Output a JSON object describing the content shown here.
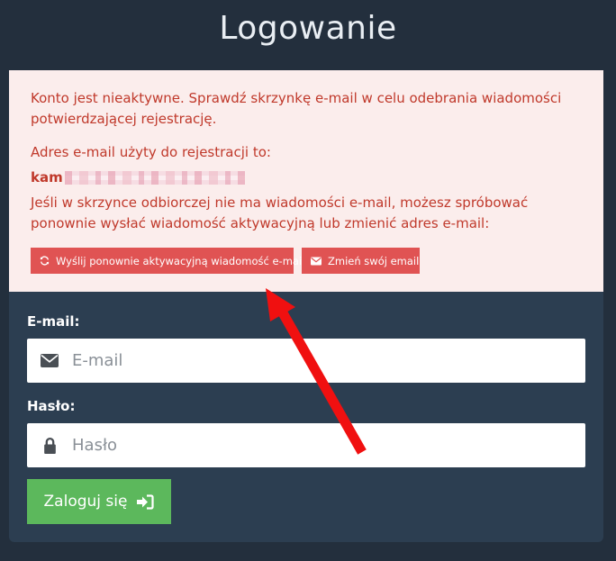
{
  "page": {
    "title": "Logowanie"
  },
  "alert": {
    "message": "Konto jest nieaktywne. Sprawdź skrzynkę e-mail w celu odebrania wiadomości potwierdzającej rejestrację.",
    "address_label": "Adres e-mail użyty do rejestracji to:",
    "email_visible": "kam",
    "instructions": "Jeśli w skrzynce odbiorczej nie ma wiadomości e-mail, możesz spróbować ponownie wysłać wiadomość aktywacyjną lub zmienić adres e-mail:",
    "resend_label": "Wyślij ponownie aktywacyjną wiadomość e-mail",
    "change_label": "Zmień swój email"
  },
  "form": {
    "email_label": "E-mail:",
    "email_placeholder": "E-mail",
    "email_value": "",
    "password_label": "Hasło:",
    "password_placeholder": "Hasło",
    "password_value": "",
    "login_label": "Zaloguj się"
  },
  "colors": {
    "background": "#232f3d",
    "card": "#2c3e51",
    "alert_bg": "#fbedec",
    "alert_text": "#c0392b",
    "danger_button": "#e05353",
    "success_button": "#5cb85c",
    "annotation_arrow": "#f01010"
  },
  "icons": {
    "resend": "refresh-icon",
    "change": "envelope-icon",
    "email_field": "envelope-icon",
    "password_field": "lock-icon",
    "login": "sign-in-icon"
  }
}
